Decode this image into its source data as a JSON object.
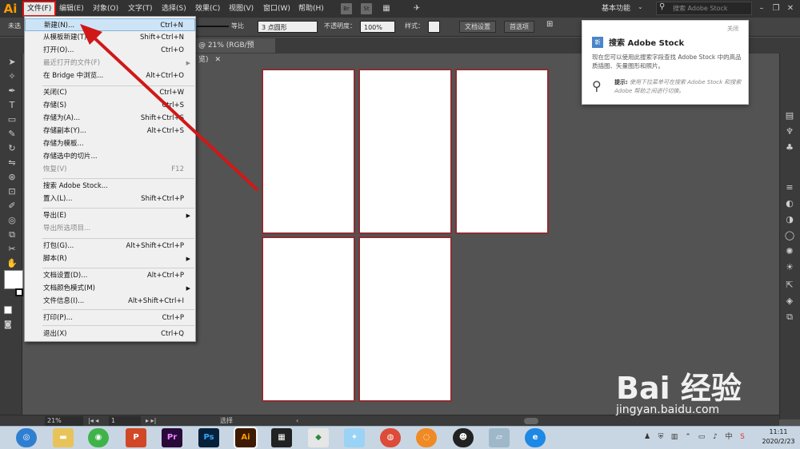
{
  "app": {
    "logo": "Ai"
  },
  "menubar": {
    "items": [
      "文件(F)",
      "编辑(E)",
      "对象(O)",
      "文字(T)",
      "选择(S)",
      "效果(C)",
      "视图(V)",
      "窗口(W)",
      "帮助(H)"
    ],
    "bridge": "Br",
    "stock": "St",
    "workspace": "基本功能",
    "stock_search_placeholder": "搜索 Adobe Stock"
  },
  "controlbar": {
    "selection_label": "未选",
    "stroke_style": "等比",
    "brush": "3 点圆形",
    "opacity_label": "不透明度：",
    "opacity_value": "100%",
    "style_label": "样式：",
    "doc_setup": "文档设置",
    "preferences": "首选项"
  },
  "document": {
    "tab": "@ 21% (RGB/预览)"
  },
  "file_menu": {
    "items": [
      {
        "label": "新建(N)...",
        "shortcut": "Ctrl+N",
        "disabled": false,
        "highlight": true
      },
      {
        "label": "从模板新建(T)...",
        "shortcut": "Shift+Ctrl+N",
        "disabled": false
      },
      {
        "label": "打开(O)...",
        "shortcut": "Ctrl+O",
        "disabled": false
      },
      {
        "label": "最近打开的文件(F)",
        "shortcut": "",
        "disabled": true,
        "submenu": true
      },
      {
        "label": "在 Bridge 中浏览...",
        "shortcut": "Alt+Ctrl+O",
        "disabled": false
      },
      {
        "label": "关闭(C)",
        "shortcut": "Ctrl+W",
        "disabled": false
      },
      {
        "label": "存储(S)",
        "shortcut": "Ctrl+S",
        "disabled": false
      },
      {
        "label": "存储为(A)...",
        "shortcut": "Shift+Ctrl+S",
        "disabled": false
      },
      {
        "label": "存储副本(Y)...",
        "shortcut": "Alt+Ctrl+S",
        "disabled": false
      },
      {
        "label": "存储为模板...",
        "shortcut": "",
        "disabled": false
      },
      {
        "label": "存储选中的切片...",
        "shortcut": "",
        "disabled": false
      },
      {
        "label": "恢复(V)",
        "shortcut": "F12",
        "disabled": true
      },
      {
        "label": "搜索 Adobe Stock...",
        "shortcut": "",
        "disabled": false
      },
      {
        "label": "置入(L)...",
        "shortcut": "Shift+Ctrl+P",
        "disabled": false
      },
      {
        "label": "导出(E)",
        "shortcut": "",
        "disabled": false,
        "submenu": true
      },
      {
        "label": "导出所选项目...",
        "shortcut": "",
        "disabled": true
      },
      {
        "label": "打包(G)...",
        "shortcut": "Alt+Shift+Ctrl+P",
        "disabled": false
      },
      {
        "label": "脚本(R)",
        "shortcut": "",
        "disabled": false,
        "submenu": true
      },
      {
        "label": "文档设置(D)...",
        "shortcut": "Alt+Ctrl+P",
        "disabled": false
      },
      {
        "label": "文档颜色模式(M)",
        "shortcut": "",
        "disabled": false,
        "submenu": true
      },
      {
        "label": "文件信息(I)...",
        "shortcut": "Alt+Shift+Ctrl+I",
        "disabled": false
      },
      {
        "label": "打印(P)...",
        "shortcut": "Ctrl+P",
        "disabled": false
      },
      {
        "label": "退出(X)",
        "shortcut": "Ctrl+Q",
        "disabled": false
      }
    ]
  },
  "stock_popup": {
    "badge": "新",
    "title": "搜索 Adobe Stock",
    "close": "关闭",
    "description": "现在您可以使用此搜索字段查找 Adobe Stock 中的高品质插图、矢量图形和照片。",
    "tip_label": "提示:",
    "tip_text": "使用下拉菜单可在搜索 Adobe Stock 和搜索 Adobe 帮助之间进行切换。"
  },
  "statusbar": {
    "zoom": "21%",
    "artboard": "1",
    "tool": "选择"
  },
  "taskbar": {
    "apps": [
      "Pr",
      "Ps",
      "Ai"
    ],
    "time": "11:11",
    "date": "2020/2/23"
  },
  "watermark": {
    "logo": "Bai 经验",
    "url": "jingyan.baidu.com"
  },
  "colors": {
    "accent": "#e01010",
    "artboard_border": "#8b2e32",
    "ai_orange": "#ff9a00"
  }
}
